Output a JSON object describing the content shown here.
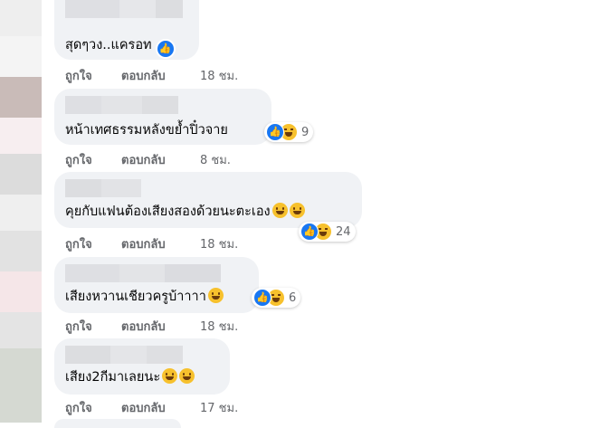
{
  "comments": [
    {
      "text": "สุดๆวง..แครอท",
      "has_like_badge": true,
      "reaction_count": "",
      "like_label": "ถูกใจ",
      "reply_label": "ตอบกลับ",
      "time": "18 ชม."
    },
    {
      "text": "หน้าเทศธรรมหลังขย้ำปิ๋วจาย",
      "reaction_count": "9",
      "like_label": "ถูกใจ",
      "reply_label": "ตอบกลับ",
      "time": "8 ชม."
    },
    {
      "text": "คุยกับแฟนต้องเสียงสองด้วยนะตะเอง",
      "reaction_count": "24",
      "like_label": "ถูกใจ",
      "reply_label": "ตอบกลับ",
      "time": "18 ชม."
    },
    {
      "text": "เสียงหวานเชียวครูบ้าาาา",
      "reaction_count": "6",
      "like_label": "ถูกใจ",
      "reply_label": "ตอบกลับ",
      "time": "18 ชม."
    },
    {
      "text": "เสียง2กีมาเลยนะ",
      "reaction_count": "",
      "like_label": "ถูกใจ",
      "reply_label": "ตอบกลับ",
      "time": "17 ชม."
    }
  ],
  "colors": {
    "bubble": "#f0f2f5",
    "like_blue": "#1877f2",
    "haha_yellow": "#f7c12d",
    "meta_gray": "#65676b"
  },
  "icons": [
    "like-icon",
    "haha-icon",
    "grin-emoji-icon",
    "rofl-emoji-icon"
  ]
}
